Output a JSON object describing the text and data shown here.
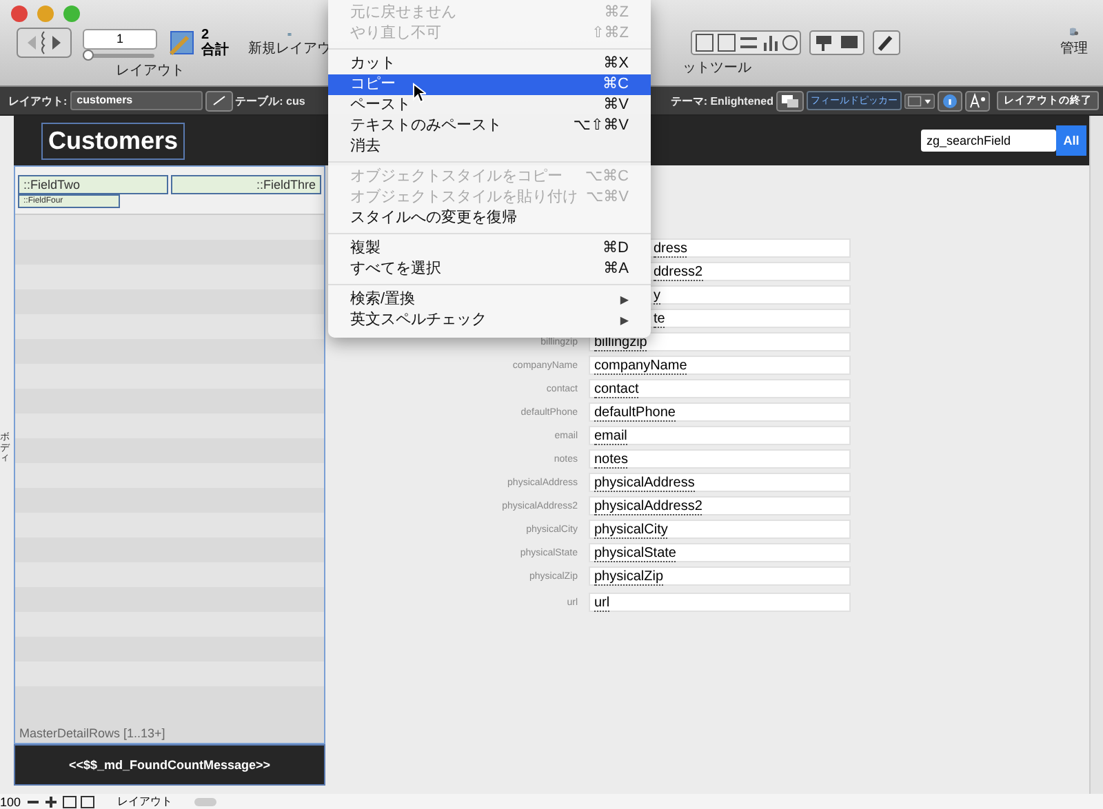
{
  "toolbar": {
    "record_field": "1",
    "record_slider": {
      "level": 0
    },
    "found_count": "2",
    "found_label": "合計",
    "layout_label": "レイアウト",
    "new_layout_label": "新規レイアウ",
    "tools_label": "ットツール",
    "manage_label": "管理"
  },
  "layout_bar": {
    "layout_label": "レイアウト:",
    "layout_value": "customers",
    "table_label": "テーブル: cus",
    "theme_label": "テーマ: Enlightened",
    "field_picker": "フィールドピッカー",
    "end_button": "レイアウトの終了"
  },
  "canvas": {
    "header_title": "Customers",
    "search_value": "zg_searchField",
    "all_button": "All",
    "body_label": "ボディ",
    "portal": {
      "header_fields": [
        "::FieldTwo",
        "::FieldThre"
      ],
      "sub_fields": [
        "::FieldFour"
      ],
      "row_label": "MasterDetailRows [1..13+]"
    },
    "footer_text": "<<$$_md_FoundCountMessage>>",
    "fields": [
      {
        "value": "dress"
      },
      {
        "value": "ddress2"
      },
      {
        "value": "y"
      },
      {
        "value": "te"
      },
      {
        "label": "billingzip",
        "value": "billingzip"
      },
      {
        "label": "companyName",
        "value": "companyName"
      },
      {
        "label": "contact",
        "value": "contact"
      },
      {
        "label": "defaultPhone",
        "value": "defaultPhone"
      },
      {
        "label": "email",
        "value": "email"
      },
      {
        "label": "notes",
        "value": "notes"
      },
      {
        "label": "physicalAddress",
        "value": "physicalAddress"
      },
      {
        "label": "physicalAddress2",
        "value": "physicalAddress2"
      },
      {
        "label": "physicalCity",
        "value": "physicalCity"
      },
      {
        "label": "physicalState",
        "value": "physicalState"
      },
      {
        "label": "physicalZip",
        "value": "physicalZip"
      },
      {
        "label": "url",
        "value": "url"
      }
    ]
  },
  "menu": [
    {
      "kind": "item",
      "label": "元に戻せません",
      "shortcut": "⌘Z",
      "disabled": true,
      "selected": false
    },
    {
      "kind": "item",
      "label": "やり直し不可",
      "shortcut": "⇧⌘Z",
      "disabled": true,
      "selected": false
    },
    {
      "kind": "separator"
    },
    {
      "kind": "item",
      "label": "カット",
      "shortcut": "⌘X",
      "disabled": false,
      "selected": false
    },
    {
      "kind": "item",
      "label": "コピー",
      "shortcut": "⌘C",
      "disabled": false,
      "selected": true
    },
    {
      "kind": "item",
      "label": "ペースト",
      "shortcut": "⌘V",
      "disabled": false,
      "selected": false
    },
    {
      "kind": "item",
      "label": "テキストのみペースト",
      "shortcut": "⌥⇧⌘V",
      "disabled": false,
      "selected": false
    },
    {
      "kind": "item",
      "label": "消去",
      "disabled": false,
      "selected": false
    },
    {
      "kind": "separator"
    },
    {
      "kind": "item",
      "label": "オブジェクトスタイルをコピー",
      "shortcut": "⌥⌘C",
      "disabled": true,
      "selected": false
    },
    {
      "kind": "item",
      "label": "オブジェクトスタイルを貼り付け",
      "shortcut": "⌥⌘V",
      "disabled": true,
      "selected": false
    },
    {
      "kind": "item",
      "label": "スタイルへの変更を復帰",
      "disabled": false,
      "selected": false
    },
    {
      "kind": "separator"
    },
    {
      "kind": "item",
      "label": "複製",
      "shortcut": "⌘D",
      "disabled": false,
      "selected": false
    },
    {
      "kind": "item",
      "label": "すべてを選択",
      "shortcut": "⌘A",
      "disabled": false,
      "selected": false
    },
    {
      "kind": "separator"
    },
    {
      "kind": "item",
      "label": "検索/置換",
      "submenu": "▶",
      "disabled": false,
      "selected": false
    },
    {
      "kind": "item",
      "label": "英文スペルチェック",
      "submenu": "▶",
      "disabled": false,
      "selected": false
    }
  ],
  "status_bar": {
    "zoom": "100",
    "tab": "レイアウト"
  }
}
